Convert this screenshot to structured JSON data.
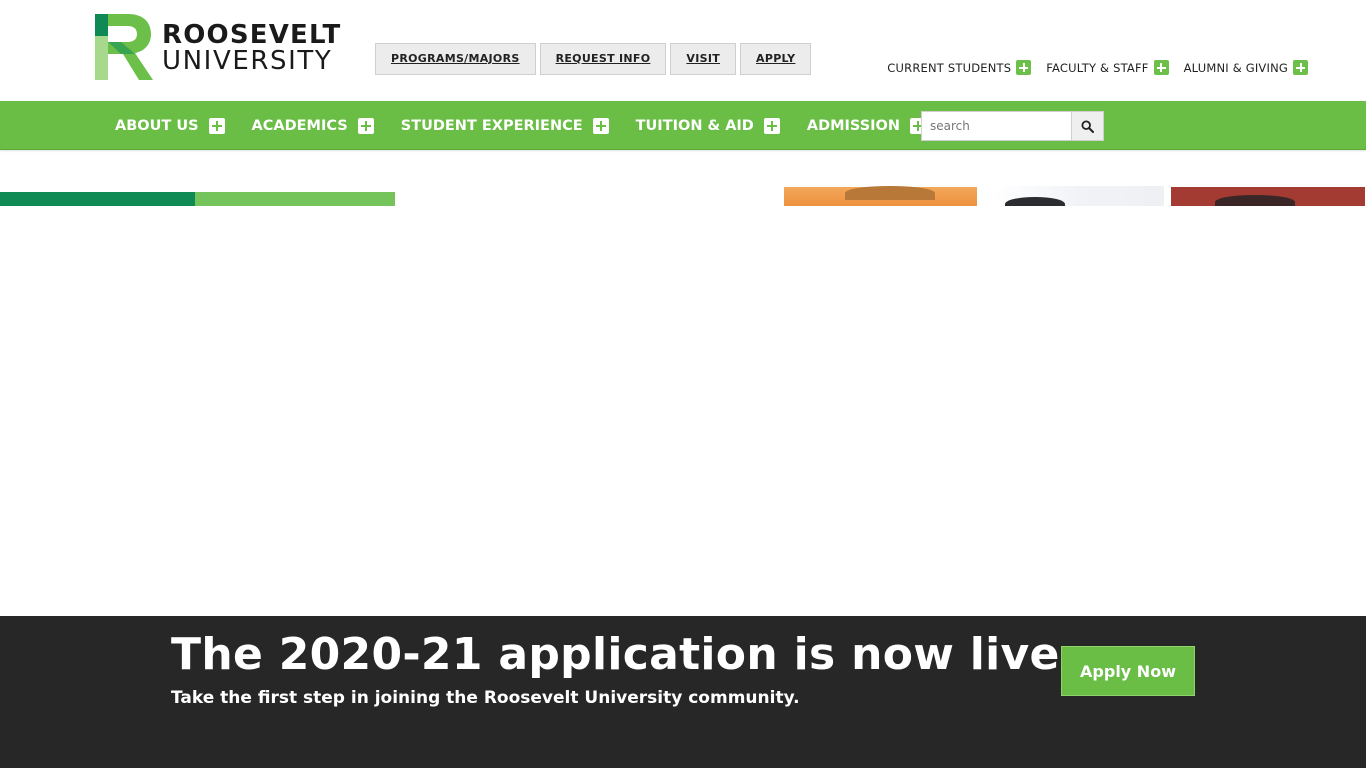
{
  "header": {
    "logo": {
      "line1": "ROOSEVELT",
      "line2": "UNIVERSITY",
      "colors": {
        "dark_green": "#0f8a55",
        "light_green": "#6cc04a",
        "pale_green": "#a6d98b"
      }
    },
    "quick_links": [
      {
        "label": "PROGRAMS/MAJORS"
      },
      {
        "label": "REQUEST INFO"
      },
      {
        "label": "VISIT"
      },
      {
        "label": "APPLY"
      }
    ],
    "audience_links": [
      {
        "label": "CURRENT STUDENTS",
        "icon": "plus-icon"
      },
      {
        "label": "FACULTY & STAFF",
        "icon": "plus-icon"
      },
      {
        "label": "ALUMNI & GIVING",
        "icon": "plus-icon"
      }
    ]
  },
  "nav": {
    "background": "#6abd45",
    "items": [
      {
        "label": "ABOUT US",
        "icon": "plus-icon"
      },
      {
        "label": "ACADEMICS",
        "icon": "plus-icon"
      },
      {
        "label": "STUDENT EXPERIENCE",
        "icon": "plus-icon"
      },
      {
        "label": "TUITION & AID",
        "icon": "plus-icon"
      },
      {
        "label": "ADMISSION",
        "icon": "plus-icon"
      }
    ],
    "search": {
      "placeholder": "search",
      "value": "",
      "icon": "search-icon"
    }
  },
  "banner": {
    "background": "#272727",
    "title": "The 2020-21 application is now live",
    "subtitle": "Take the first step in joining the Roosevelt University community.",
    "cta_label": "Apply Now",
    "cta_color": "#6abd45"
  }
}
